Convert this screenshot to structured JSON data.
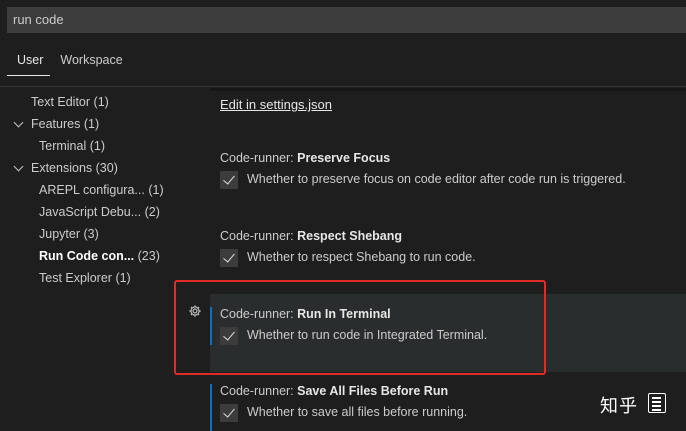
{
  "search": {
    "value": "run code"
  },
  "tabs": [
    {
      "label": "User",
      "active": true
    },
    {
      "label": "Workspace",
      "active": false
    }
  ],
  "tree": {
    "items": [
      {
        "label": "Text Editor",
        "count": "(1)"
      },
      {
        "label": "Features",
        "count": "(1)"
      },
      {
        "label": "Terminal",
        "count": "(1)"
      },
      {
        "label": "Extensions",
        "count": "(30)"
      },
      {
        "label": "AREPL configura...",
        "count": "(1)"
      },
      {
        "label": "JavaScript Debu...",
        "count": "(2)"
      },
      {
        "label": "Jupyter",
        "count": "(3)"
      },
      {
        "label": "Run Code con...",
        "count": "(23)"
      },
      {
        "label": "Test Explorer",
        "count": "(1)"
      }
    ]
  },
  "main": {
    "edit_link": "Edit in settings.json",
    "settings": [
      {
        "prefix": "Code-runner: ",
        "key": "Preserve Focus",
        "description": "Whether to preserve focus on code editor after code run is triggered.",
        "checked": true
      },
      {
        "prefix": "Code-runner: ",
        "key": "Respect Shebang",
        "description": "Whether to respect Shebang to run code.",
        "checked": true
      },
      {
        "prefix": "Code-runner: ",
        "key": "Run In Terminal",
        "description": "Whether to run code in Integrated Terminal.",
        "checked": true
      },
      {
        "prefix": "Code-runner: ",
        "key": "Save All Files Before Run",
        "description": "Whether to save all files before running.",
        "checked": true
      }
    ]
  },
  "icons": {
    "settings": "gear-icon",
    "expand": "chevron-down-icon"
  },
  "colors": {
    "highlight": "#e02b26",
    "modified_bar": "#0e70c0",
    "background": "#1e1e1e"
  },
  "watermark": {
    "text": "知乎"
  }
}
